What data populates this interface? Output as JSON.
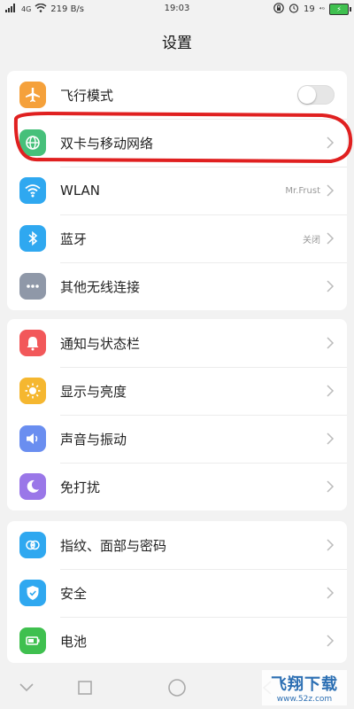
{
  "statusbar": {
    "network": "4G",
    "speed": "219 B/s",
    "time": "19:03",
    "battery_label": "19"
  },
  "title": "设置",
  "groups": [
    {
      "items": [
        {
          "label": "飞行模式",
          "icon": "airplane-icon",
          "color": "#f5a13b",
          "control": "toggle",
          "toggle_on": false
        },
        {
          "label": "双卡与移动网络",
          "icon": "globe-icon",
          "color": "#46c07a",
          "control": "chevron"
        },
        {
          "label": "WLAN",
          "icon": "wifi-icon",
          "color": "#2fa8f0",
          "control": "chevron",
          "value": "Mr.Frust"
        },
        {
          "label": "蓝牙",
          "icon": "bluetooth-icon",
          "color": "#2fa8f0",
          "control": "chevron",
          "value": "关闭"
        },
        {
          "label": "其他无线连接",
          "icon": "more-icon",
          "color": "#8f98a8",
          "control": "chevron"
        }
      ]
    },
    {
      "items": [
        {
          "label": "通知与状态栏",
          "icon": "bell-icon",
          "color": "#f2585a",
          "control": "chevron"
        },
        {
          "label": "显示与亮度",
          "icon": "sun-icon",
          "color": "#f5b730",
          "control": "chevron"
        },
        {
          "label": "声音与振动",
          "icon": "speaker-icon",
          "color": "#6a8ef0",
          "control": "chevron"
        },
        {
          "label": "免打扰",
          "icon": "moon-icon",
          "color": "#9a77e8",
          "control": "chevron"
        }
      ]
    },
    {
      "items": [
        {
          "label": "指纹、面部与密码",
          "icon": "fingerprint-icon",
          "color": "#2fa8f0",
          "control": "chevron"
        },
        {
          "label": "安全",
          "icon": "shield-icon",
          "color": "#2fa8f0",
          "control": "chevron"
        },
        {
          "label": "电池",
          "icon": "battery-icon",
          "color": "#3fc04f",
          "control": "chevron"
        }
      ]
    }
  ],
  "annotation_color": "#e02020",
  "watermark": {
    "text": "飞翔下载",
    "sub": "www.52z.com"
  }
}
